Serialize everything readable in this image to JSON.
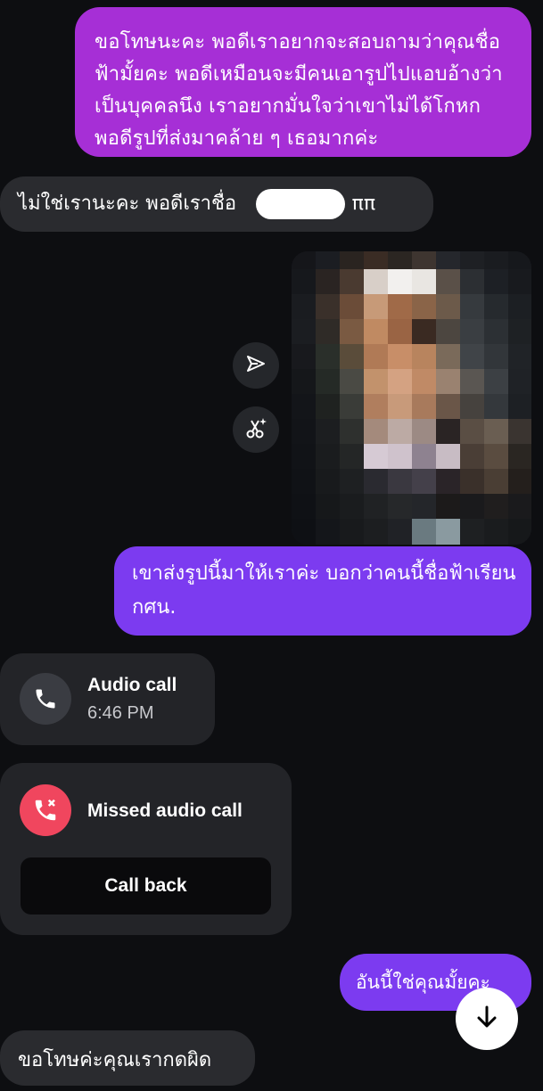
{
  "messages": {
    "outgoing_1": "ขอโทษนะคะ พอดีเราอยากจะสอบถามว่าคุณชื่อฟ้ามั้ยคะ พอดีเหมือนจะมีคนเอารูปไปแอบอ้างว่าเป็นบุคคลนึง เราอยากมั่นใจว่าเขาไม่ได้โกหก พอดีรูปที่ส่งมาคล้าย ๆ เธอมากค่ะ",
    "incoming_1": "ไม่ใช่เรานะคะ พอดีเราชื่อ",
    "incoming_1_suffix": "ค่ะ ππ",
    "outgoing_2": "เขาส่งรูปนี้มาให้เราค่ะ บอกว่าคนนี้ชื่อฟ้าเรียนกศน.",
    "outgoing_3": "อันนี้ใช่คุณมั้ยคะ",
    "incoming_2": "ขอโทษค่ะคุณเรากดผิด"
  },
  "calls": {
    "audio": {
      "title": "Audio call",
      "time": "6:46 PM"
    },
    "missed": {
      "title": "Missed audio call",
      "action": "Call back"
    }
  },
  "icons": {
    "share": "send-outline-icon",
    "cutout": "scissors-sparkle-icon",
    "phone": "phone-icon",
    "missed_phone": "missed-call-icon",
    "scroll": "arrow-down-icon"
  },
  "colors": {
    "background": "#0d0e11",
    "bubble_purple": "#a62fd6",
    "bubble_violet": "#7c3bf0",
    "bubble_incoming": "#2a2b2f",
    "missed_red": "#f0465e"
  }
}
